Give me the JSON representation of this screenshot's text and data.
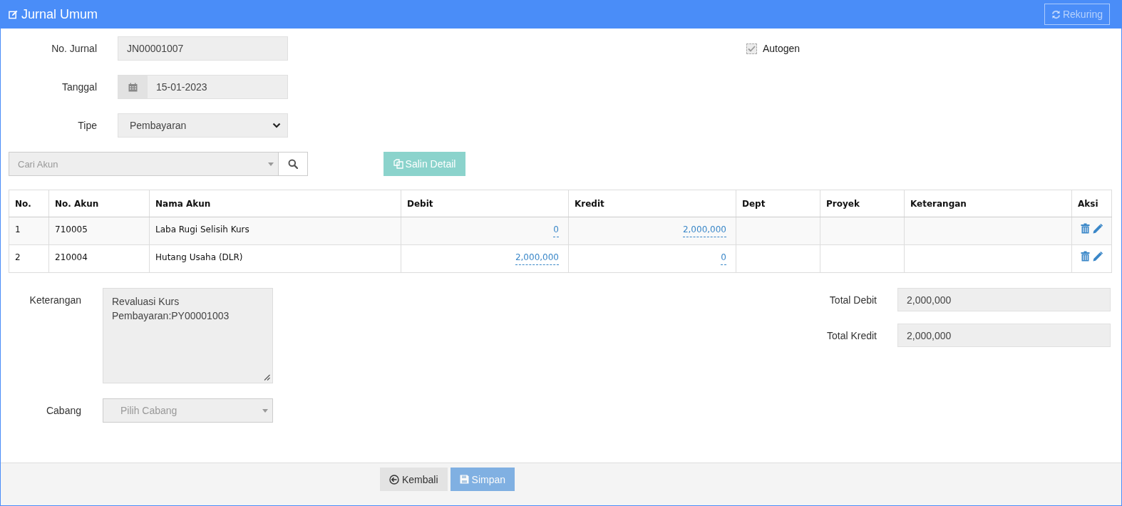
{
  "header": {
    "title": "Jurnal Umum",
    "rekuring_button": {
      "label": "Rekuring",
      "disabled": true
    }
  },
  "form": {
    "fields": [
      {
        "label": "No. Jurnal",
        "value": "JN00001007",
        "kind": "text"
      },
      {
        "label": "Tanggal",
        "value": "15-01-2023",
        "kind": "date"
      },
      {
        "label": "Tipe",
        "value": "Pembayaran",
        "kind": "select"
      }
    ],
    "autogen": {
      "label": "Autogen",
      "checked": true,
      "disabled": true
    }
  },
  "toolbar": {
    "account_search": {
      "placeholder": "Cari Akun"
    },
    "copy_button": {
      "label": "Salin Detail",
      "disabled": true
    }
  },
  "table": {
    "columns": [
      "No.",
      "No. Akun",
      "Nama Akun",
      "Debit",
      "Kredit",
      "Dept",
      "Proyek",
      "Keterangan",
      "Aksi"
    ],
    "rows": [
      {
        "no": "1",
        "account_no": "710005",
        "account_name": "Laba Rugi Selisih Kurs",
        "debit": "0",
        "kredit": "2,000,000"
      },
      {
        "no": "2",
        "account_no": "210004",
        "account_name": "Hutang Usaha (DLR)",
        "debit": "2,000,000",
        "kredit": "0"
      }
    ]
  },
  "notes": {
    "label": "Keterangan",
    "value": "Revaluasi Kurs\nPembayaran:PY00001003"
  },
  "branch": {
    "label": "Cabang",
    "placeholder": "Pilih Cabang"
  },
  "totals": [
    {
      "label": "Total Debit",
      "value": "2,000,000"
    },
    {
      "label": "Total Kredit",
      "value": "2,000,000"
    }
  ],
  "footer": {
    "buttons": [
      {
        "label": "Kembali",
        "kind": "back",
        "disabled": false
      },
      {
        "label": "Simpan",
        "kind": "save",
        "disabled": true
      }
    ]
  }
}
